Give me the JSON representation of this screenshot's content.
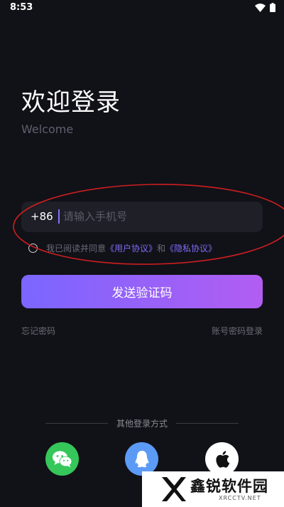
{
  "status_bar": {
    "time": "8:53",
    "wifi_icon": "wifi-icon",
    "battery_icon": "battery-icon"
  },
  "header": {
    "title": "欢迎登录",
    "subtitle": "Welcome"
  },
  "phone": {
    "country_code": "+86",
    "placeholder": "请输入手机号",
    "value": ""
  },
  "agreement": {
    "checked": false,
    "prefix": "我已阅读并同意",
    "user_agreement": "《用户协议》",
    "conjunction": "和",
    "privacy_policy": "《隐私协议》"
  },
  "actions": {
    "send_code": "发送验证码",
    "forgot_password": "忘记密码",
    "password_login": "账号密码登录"
  },
  "other_login": {
    "label": "其他登录方式",
    "options": [
      {
        "icon": "wechat-icon",
        "color": "#35c759"
      },
      {
        "icon": "qq-icon",
        "color": "#5b9bf5"
      },
      {
        "icon": "apple-icon",
        "color": "#ffffff"
      }
    ]
  },
  "theme": {
    "background": "#111118",
    "accent_start": "#7a66ff",
    "accent_end": "#b25df2",
    "link": "#7d6cf6",
    "annotation": "#cc1f1f"
  },
  "watermark": {
    "name": "鑫锐软件园",
    "site": "XRCCTV.NET"
  }
}
